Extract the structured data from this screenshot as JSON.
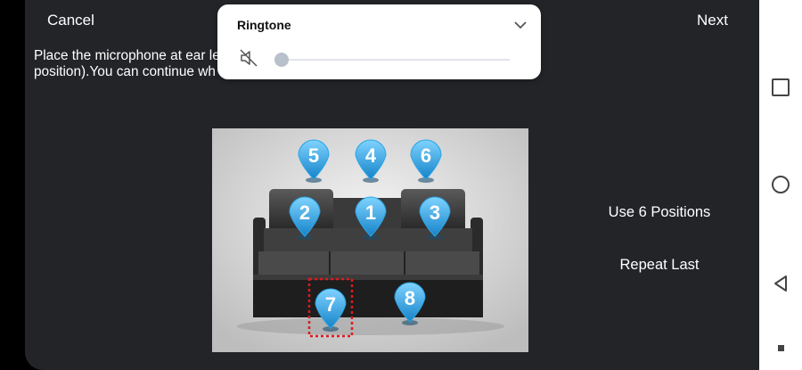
{
  "header": {
    "cancel_label": "Cancel",
    "next_label": "Next"
  },
  "instructions": {
    "line1": "Place the microphone at ear le                                                                            cm)away from the 1st",
    "line2": "position).You can continue wh                                                                            downloaded from the AV receiver."
  },
  "diagram": {
    "markers": [
      {
        "number": "1",
        "name": "position-1-marker",
        "highlighted": false
      },
      {
        "number": "2",
        "name": "position-2-marker",
        "highlighted": false
      },
      {
        "number": "3",
        "name": "position-3-marker",
        "highlighted": false
      },
      {
        "number": "4",
        "name": "position-4-marker",
        "highlighted": false
      },
      {
        "number": "5",
        "name": "position-5-marker",
        "highlighted": false
      },
      {
        "number": "6",
        "name": "position-6-marker",
        "highlighted": false
      },
      {
        "number": "7",
        "name": "position-7-marker",
        "highlighted": true
      },
      {
        "number": "8",
        "name": "position-8-marker",
        "highlighted": false
      }
    ],
    "marker_color": "#2aa5e6",
    "highlight_color": "#e0191e"
  },
  "options": {
    "use_positions_label": "Use 6 Positions",
    "repeat_last_label": "Repeat Last"
  },
  "volume_popup": {
    "title": "Ringtone",
    "level_fraction": 0.0,
    "mute_icon": "volume-mute-icon",
    "expand_icon": "chevron-down-icon"
  },
  "navbar": {
    "icons": [
      "recent-apps-icon",
      "home-icon",
      "back-icon",
      "status-dot-icon"
    ]
  }
}
